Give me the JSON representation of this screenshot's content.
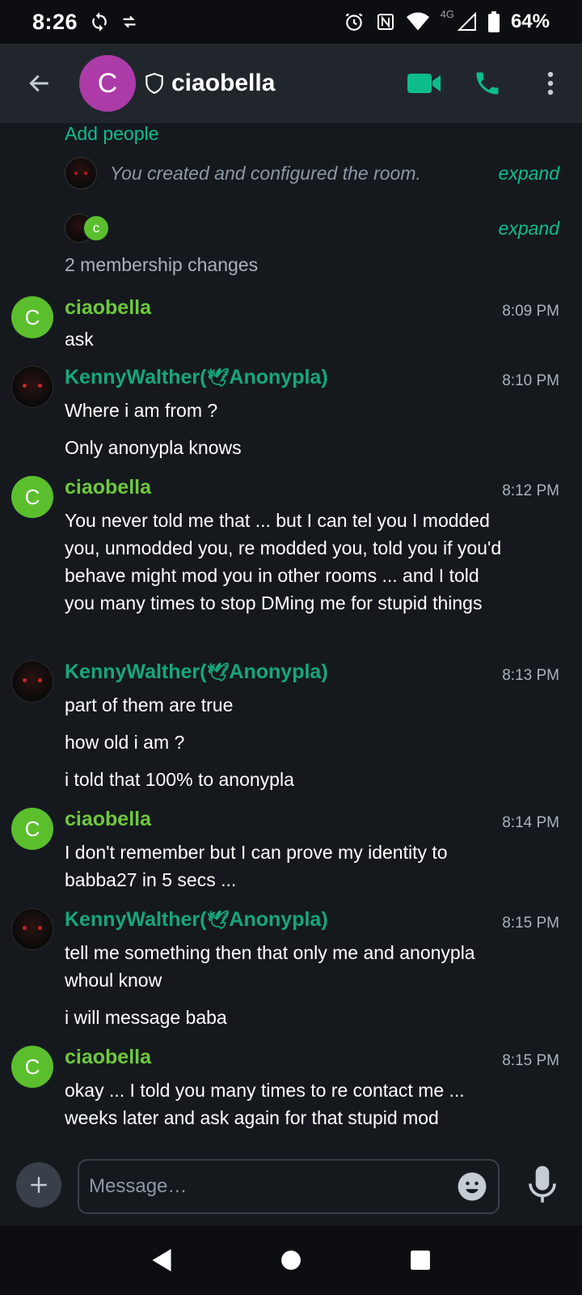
{
  "status_bar": {
    "time": "8:26",
    "network": "4G",
    "battery": "64%"
  },
  "header": {
    "avatar_letter": "C",
    "room_name": "ciaobella",
    "avatar_color": "#ac3ba8",
    "accent_color": "#0dbd8b"
  },
  "timeline": {
    "add_people": "Add people",
    "created_notice": "You created and configured the room.",
    "expand_label": "expand",
    "membership_changes": "2 membership changes",
    "membership_avatar_letter": "c",
    "messages": [
      {
        "sender": "ciaobella",
        "avatar": "C",
        "time": "8:09 PM",
        "bodies": [
          "ask"
        ]
      },
      {
        "sender": "KennyWalther(",
        "sender_suffix": "Anonypla)",
        "time": "8:10 PM",
        "bodies": [
          "Where i am from ?",
          "Only anonypla knows"
        ]
      },
      {
        "sender": "ciaobella",
        "avatar": "C",
        "time": "8:12 PM",
        "bodies": [
          "You never told me that ... but I can tel you I modded you, unmodded you, re modded you, told you if you'd behave  might mod you in other rooms ... and I told you many times to stop DMing me for stupid things"
        ]
      },
      {
        "sender": "KennyWalther(",
        "sender_suffix": "Anonypla)",
        "time": "8:13 PM",
        "bodies": [
          "part of them are true",
          "how old i am ?",
          "i told that 100% to anonypla"
        ]
      },
      {
        "sender": "ciaobella",
        "avatar": "C",
        "time": "8:14 PM",
        "bodies": [
          "I don't remember but I can prove my identity to babba27 in 5 secs ..."
        ]
      },
      {
        "sender": "KennyWalther(",
        "sender_suffix": "Anonypla)",
        "time": "8:15 PM",
        "bodies": [
          "tell me something then that only me and anonypla whoul know",
          "i will message baba"
        ]
      },
      {
        "sender": "ciaobella",
        "avatar": "C",
        "time": "8:15 PM",
        "bodies": [
          "okay ... I told you many times to re contact me ... weeks later and ask again for that stupid mod"
        ]
      }
    ]
  },
  "composer": {
    "placeholder": "Message…"
  },
  "icons": {
    "back": "back-arrow-icon",
    "shield": "shield-icon",
    "video": "video-call-icon",
    "call": "phone-icon",
    "more": "more-vert-icon",
    "attach": "plus-icon",
    "emoji": "emoji-icon",
    "mic": "microphone-icon"
  }
}
